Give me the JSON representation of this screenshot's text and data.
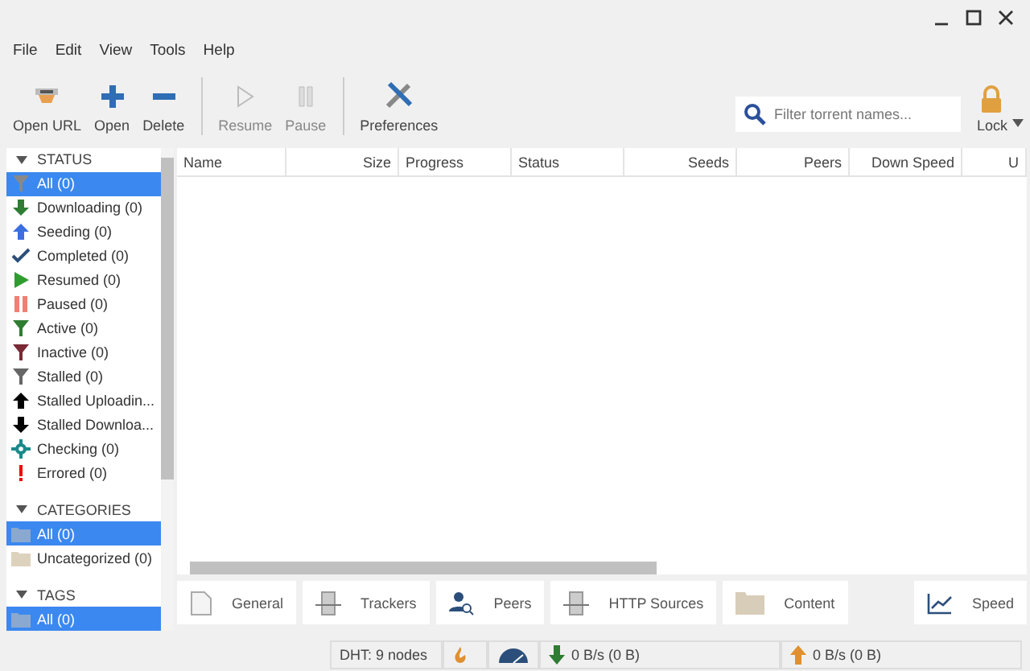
{
  "menu": [
    "File",
    "Edit",
    "View",
    "Tools",
    "Help"
  ],
  "toolbar": [
    {
      "label": "Open URL",
      "disabled": false
    },
    {
      "label": "Open",
      "disabled": false
    },
    {
      "label": "Delete",
      "disabled": false
    },
    {
      "label": "Resume",
      "disabled": true
    },
    {
      "label": "Pause",
      "disabled": true
    },
    {
      "label": "Preferences",
      "disabled": false
    }
  ],
  "search": {
    "placeholder": "Filter torrent names..."
  },
  "lock": {
    "label": "Lock"
  },
  "sidebar": {
    "sections": [
      {
        "title": "STATUS",
        "expanded": true,
        "items": [
          {
            "label": "All (0)",
            "selected": true
          },
          {
            "label": "Downloading (0)",
            "selected": false
          },
          {
            "label": "Seeding (0)",
            "selected": false
          },
          {
            "label": "Completed (0)",
            "selected": false
          },
          {
            "label": "Resumed (0)",
            "selected": false
          },
          {
            "label": "Paused (0)",
            "selected": false
          },
          {
            "label": "Active (0)",
            "selected": false
          },
          {
            "label": "Inactive (0)",
            "selected": false
          },
          {
            "label": "Stalled (0)",
            "selected": false
          },
          {
            "label": "Stalled Uploadin...",
            "selected": false
          },
          {
            "label": "Stalled Downloa...",
            "selected": false
          },
          {
            "label": "Checking (0)",
            "selected": false
          },
          {
            "label": "Errored (0)",
            "selected": false
          }
        ]
      },
      {
        "title": "CATEGORIES",
        "expanded": true,
        "items": [
          {
            "label": "All (0)",
            "selected": true
          },
          {
            "label": "Uncategorized (0)",
            "selected": false
          }
        ]
      },
      {
        "title": "TAGS",
        "expanded": true,
        "items": [
          {
            "label": "All (0)",
            "selected": true
          }
        ]
      }
    ]
  },
  "table": {
    "columns": [
      "Name",
      "Size",
      "Progress",
      "Status",
      "Seeds",
      "Peers",
      "Down Speed",
      "U"
    ]
  },
  "detail_tabs": [
    "General",
    "Trackers",
    "Peers",
    "HTTP Sources",
    "Content"
  ],
  "speed_tab": "Speed",
  "status_bar": {
    "dht": "DHT: 9 nodes",
    "download": "0 B/s (0 B)",
    "upload": "0 B/s (0 B)"
  }
}
